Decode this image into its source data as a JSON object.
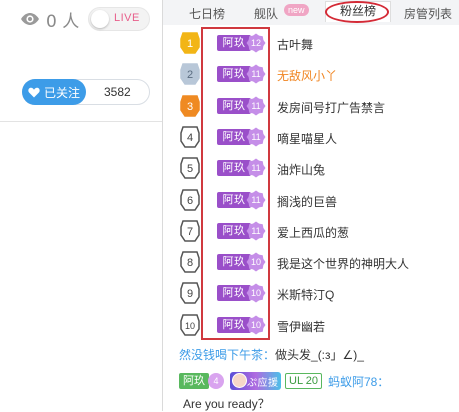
{
  "viewer": {
    "icon": "eye-icon",
    "count": "0 人"
  },
  "live_toggle": {
    "label": "LIVE",
    "on": false
  },
  "follow": {
    "label": "已关注",
    "icon": "heart-icon",
    "count": "3582"
  },
  "tabs": [
    {
      "label": "七日榜"
    },
    {
      "label": "舰队",
      "badge": "new"
    },
    {
      "label": "粉丝榜",
      "active": true
    },
    {
      "label": "房管列表"
    }
  ],
  "fan_rank": [
    {
      "rank": "1",
      "badge_name": "阿玖",
      "badge_level": "12",
      "name": "古叶舞"
    },
    {
      "rank": "2",
      "badge_name": "阿玖",
      "badge_level": "11",
      "name": "无敌风小丫"
    },
    {
      "rank": "3",
      "badge_name": "阿玖",
      "badge_level": "11",
      "name": "发房间号打广告禁言"
    },
    {
      "rank": "4",
      "badge_name": "阿玖",
      "badge_level": "11",
      "name": "嘀星喵星人"
    },
    {
      "rank": "5",
      "badge_name": "阿玖",
      "badge_level": "11",
      "name": "油炸山兔"
    },
    {
      "rank": "6",
      "badge_name": "阿玖",
      "badge_level": "11",
      "name": "搁浅的巨兽"
    },
    {
      "rank": "7",
      "badge_name": "阿玖",
      "badge_level": "11",
      "name": "爱上西瓜的葱"
    },
    {
      "rank": "8",
      "badge_name": "阿玖",
      "badge_level": "10",
      "name": "我是这个世界的神明大人"
    },
    {
      "rank": "9",
      "badge_name": "阿玖",
      "badge_level": "10",
      "name": "米斯特汀Q"
    },
    {
      "rank": "10",
      "badge_name": "阿玖",
      "badge_level": "10",
      "name": "雪伊幽若"
    }
  ],
  "colors": {
    "medal_gold": "#f2b516",
    "medal_silver": "#b8c7d8",
    "medal_bronze": "#ef8a22",
    "medal_plain": "#ffffff",
    "badge_purple": "#9a4fc9",
    "highlight_red": "#d0393f",
    "accent_blue": "#3d9ce8"
  },
  "chat": {
    "line1": {
      "user": "然没钱喝下午茶：",
      "message": "做头发_(:з」∠)_"
    },
    "line2": {
      "fan_badge_name": "阿玖",
      "fan_badge_level": "4",
      "avatar_badge_text": "ぷ应援",
      "ul_badge": "UL 20",
      "user": "蚂蚁阿78："
    },
    "line3": {
      "message": "Are you ready？"
    }
  }
}
